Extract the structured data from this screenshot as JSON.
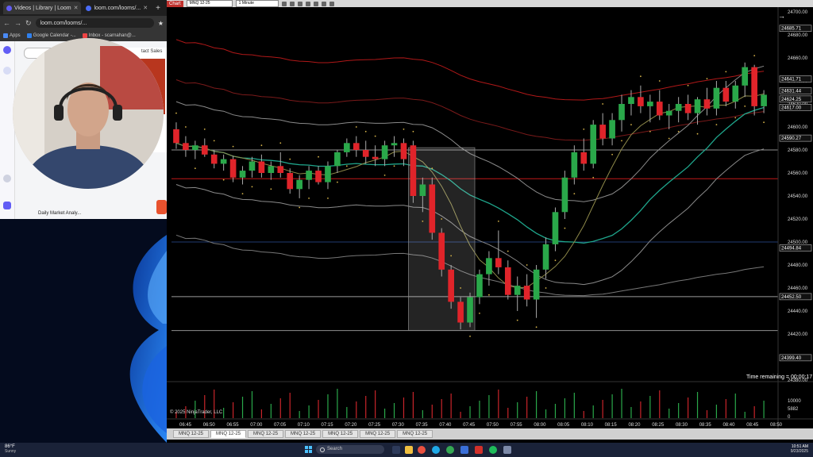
{
  "browser": {
    "tabs": [
      {
        "label": "Videos | Library | Loom"
      },
      {
        "label": "loom.com/looms/..."
      }
    ],
    "url": "loom.com/looms/...",
    "bookmarks": [
      "Apps",
      "Google Calendar -...",
      "Inbox - scarnahan@..."
    ],
    "page_title": "Daily Market Analy...",
    "card_label": "tact Sales"
  },
  "ninjatrader": {
    "chart_button": "Chart",
    "instrument": "MNQ 12-25",
    "interval": "1 Minute",
    "copyright": "© 2025 NinjaTrader, LLC",
    "time_remaining": "Time remaining = 00:00:17",
    "tabs": [
      "MNQ 12-25",
      "MNQ 12-25",
      "MNQ 12-25",
      "MNQ 12-25",
      "MNQ 12-25",
      "MNQ 12-25",
      "MNQ 12-25"
    ],
    "active_tab": 1
  },
  "taskbar": {
    "weather_temp": "86°F",
    "weather_desc": "Sunny",
    "search_placeholder": "Search",
    "time": "10:51 AM",
    "date": "9/23/2025"
  },
  "chart_data": {
    "type": "candlestick",
    "instrument": "MNQ 12-25",
    "interval": "1 Minute",
    "ylim": [
      24380,
      24700
    ],
    "y_ticks": [
      24380,
      24400,
      24420,
      24440,
      24460,
      24480,
      24500,
      24520,
      24540,
      24560,
      24580,
      24600,
      24620,
      24640,
      24660,
      24680,
      24700
    ],
    "x_tick_labels": [
      "06:45",
      "06:50",
      "06:55",
      "07:00",
      "07:05",
      "07:10",
      "07:15",
      "07:20",
      "07:25",
      "07:30",
      "07:35",
      "07:40",
      "07:45",
      "07:50",
      "07:55",
      "08:00",
      "08:05",
      "08:10",
      "08:15",
      "08:20",
      "08:25",
      "08:30",
      "08:35",
      "08:40",
      "08:45",
      "08:50"
    ],
    "price_labels": [
      {
        "value": 24685.71,
        "color": "#ffffff"
      },
      {
        "value": 24641.71,
        "color": "#ffffff"
      },
      {
        "value": 24631.44,
        "color": "#ffffff"
      },
      {
        "value": 24624.25,
        "color": "#ffffff"
      },
      {
        "value": 24617.0,
        "color": "#ffffff"
      },
      {
        "value": 24590.27,
        "color": "#ffffff"
      },
      {
        "value": 24494.84,
        "color": "#ffffff"
      },
      {
        "value": 24452.5,
        "color": "#ffffff"
      },
      {
        "value": 24399.4,
        "color": "#ffffff"
      }
    ],
    "horizontal_lines": [
      {
        "value": 24580,
        "color": "#8f8f8f"
      },
      {
        "value": 24555,
        "color": "#c01818"
      },
      {
        "value": 24500,
        "color": "#1f3a70"
      },
      {
        "value": 24452.5,
        "color": "#9a9a9a"
      },
      {
        "value": 24423,
        "color": "#8f8f8f"
      }
    ],
    "highlight_zone": {
      "from_bar": 25,
      "to_bar": 31,
      "y_low": 24423,
      "y_high": 24582
    },
    "candles": [
      [
        24598,
        24604,
        24581,
        24586
      ],
      [
        24586,
        24592,
        24574,
        24580
      ],
      [
        24580,
        24588,
        24572,
        24584
      ],
      [
        24584,
        24590,
        24574,
        24576
      ],
      [
        24576,
        24580,
        24564,
        24568
      ],
      [
        24568,
        24576,
        24562,
        24572
      ],
      [
        24572,
        24575,
        24552,
        24556
      ],
      [
        24556,
        24566,
        24550,
        24562
      ],
      [
        24562,
        24574,
        24556,
        24570
      ],
      [
        24570,
        24576,
        24556,
        24560
      ],
      [
        24560,
        24570,
        24554,
        24566
      ],
      [
        24566,
        24578,
        24556,
        24560
      ],
      [
        24560,
        24564,
        24542,
        24546
      ],
      [
        24546,
        24558,
        24538,
        24554
      ],
      [
        24554,
        24566,
        24546,
        24562
      ],
      [
        24562,
        24566,
        24550,
        24552
      ],
      [
        24552,
        24570,
        24546,
        24566
      ],
      [
        24566,
        24580,
        24560,
        24578
      ],
      [
        24578,
        24590,
        24574,
        24586
      ],
      [
        24586,
        24592,
        24574,
        24580
      ],
      [
        24580,
        24588,
        24568,
        24574
      ],
      [
        24574,
        24584,
        24566,
        24572
      ],
      [
        24572,
        24588,
        24566,
        24584
      ],
      [
        24584,
        24592,
        24574,
        24586
      ],
      [
        24586,
        24590,
        24566,
        24572
      ],
      [
        24584,
        24588,
        24534,
        24540
      ],
      [
        24540,
        24556,
        24526,
        24550
      ],
      [
        24550,
        24556,
        24502,
        24508
      ],
      [
        24508,
        24512,
        24470,
        24476
      ],
      [
        24476,
        24480,
        24442,
        24448
      ],
      [
        24448,
        24452,
        24424,
        24430
      ],
      [
        24430,
        24456,
        24426,
        24452
      ],
      [
        24452,
        24476,
        24446,
        24472
      ],
      [
        24472,
        24492,
        24462,
        24486
      ],
      [
        24486,
        24510,
        24472,
        24478
      ],
      [
        24478,
        24484,
        24450,
        24454
      ],
      [
        24454,
        24470,
        24440,
        24462
      ],
      [
        24462,
        24472,
        24444,
        24450
      ],
      [
        24450,
        24480,
        24434,
        24476
      ],
      [
        24476,
        24504,
        24468,
        24498
      ],
      [
        24498,
        24530,
        24492,
        24526
      ],
      [
        24526,
        24562,
        24520,
        24556
      ],
      [
        24556,
        24584,
        24550,
        24578
      ],
      [
        24578,
        24590,
        24562,
        24568
      ],
      [
        24568,
        24606,
        24564,
        24602
      ],
      [
        24602,
        24612,
        24584,
        24590
      ],
      [
        24590,
        24612,
        24584,
        24606
      ],
      [
        24606,
        24628,
        24596,
        24620
      ],
      [
        24620,
        24632,
        24610,
        24626
      ],
      [
        24626,
        24636,
        24612,
        24618
      ],
      [
        24618,
        24628,
        24604,
        24622
      ],
      [
        24622,
        24632,
        24606,
        24610
      ],
      [
        24610,
        24620,
        24598,
        24614
      ],
      [
        24614,
        24626,
        24604,
        24620
      ],
      [
        24620,
        24628,
        24606,
        24612
      ],
      [
        24612,
        24626,
        24602,
        24624
      ],
      [
        24624,
        24634,
        24610,
        24616
      ],
      [
        24616,
        24640,
        24610,
        24634
      ],
      [
        24634,
        24640,
        24618,
        24622
      ],
      [
        24622,
        24640,
        24616,
        24636
      ],
      [
        24636,
        24656,
        24626,
        24652
      ],
      [
        24652,
        24654,
        24610,
        24618
      ],
      [
        24618,
        24632,
        24612,
        24628
      ]
    ],
    "volume_ticks": [
      10000,
      5882,
      0
    ]
  }
}
